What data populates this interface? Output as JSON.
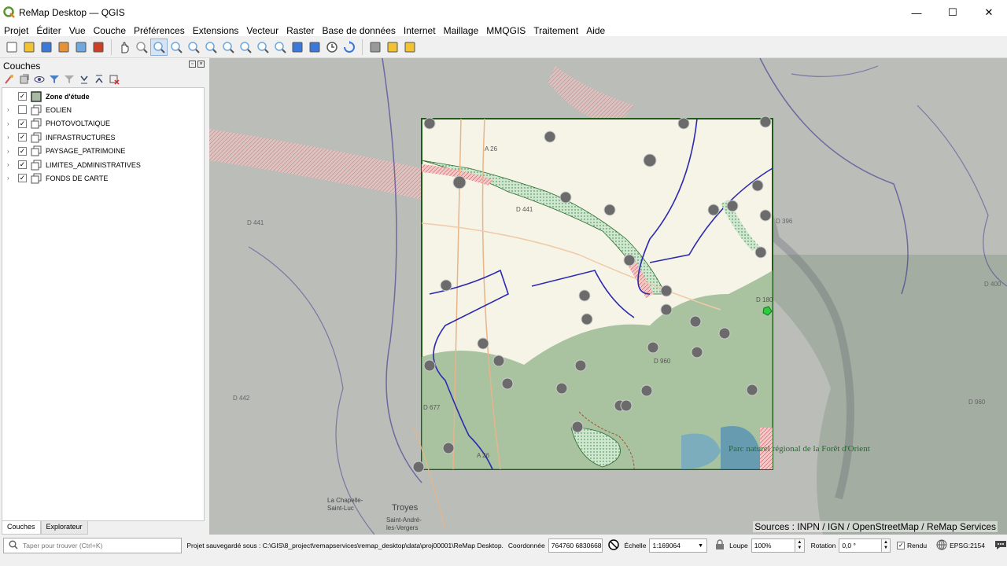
{
  "window": {
    "title": "ReMap Desktop — QGIS",
    "minimize": "—",
    "maximize": "☐",
    "close": "✕"
  },
  "menu": [
    "Projet",
    "Éditer",
    "Vue",
    "Couche",
    "Préférences",
    "Extensions",
    "Vecteur",
    "Raster",
    "Base de données",
    "Internet",
    "Maillage",
    "MMQGIS",
    "Traitement",
    "Aide"
  ],
  "toolbar_icons": [
    "new-project",
    "open-project",
    "save-project",
    "save-as",
    "print-layout",
    "style-manager",
    "pan",
    "pan-to-selection",
    "zoom-in",
    "zoom-out",
    "zoom-full",
    "zoom-to-selection",
    "zoom-to-layer",
    "zoom-native",
    "zoom-last",
    "zoom-next",
    "new-bookmark",
    "show-bookmarks",
    "temporal-controller",
    "refresh",
    "identify",
    "select",
    "deselect"
  ],
  "layers_panel": {
    "title": "Couches",
    "layers": [
      {
        "name": "Zone d'étude",
        "checked": true,
        "bold": true,
        "expandable": false
      },
      {
        "name": "EOLIEN",
        "checked": false,
        "bold": false,
        "expandable": true
      },
      {
        "name": "PHOTOVOLTAIQUE",
        "checked": true,
        "bold": false,
        "expandable": true
      },
      {
        "name": "INFRASTRUCTURES",
        "checked": true,
        "bold": false,
        "expandable": true
      },
      {
        "name": "PAYSAGE_PATRIMOINE",
        "checked": true,
        "bold": false,
        "expandable": true
      },
      {
        "name": "LIMITES_ADMINISTRATIVES",
        "checked": true,
        "bold": false,
        "expandable": true
      },
      {
        "name": "FONDS DE CARTE",
        "checked": true,
        "bold": false,
        "expandable": true
      }
    ],
    "tabs": [
      "Couches",
      "Explorateur"
    ]
  },
  "map": {
    "sources": "Sources : INPN / IGN / OpenStreetMap / ReMap Services",
    "road_labels": [
      "A 26",
      "D 441",
      "D 441",
      "D 396",
      "D 400",
      "D 180",
      "D 960",
      "D 677",
      "A 26",
      "D 442",
      "D 960"
    ],
    "place_labels": [
      "Troyes",
      "La Chapelle-Saint-Luc",
      "Saint-André-les-Vergers",
      "Parc naturel régional de la Forêt d'Orient"
    ]
  },
  "statusbar": {
    "search_placeholder": "Taper pour trouver (Ctrl+K)",
    "saved_message": "Projet sauvegardé sous : C:\\GIS\\8_project\\remapservices\\remap_desktop\\data\\proj00001\\ReMap Desktop.",
    "coord_label": "Coordonnée",
    "coord_value": "764760 6830668",
    "scale_label": "Échelle",
    "scale_value": "1:169064",
    "magnifier_label": "Loupe",
    "magnifier_value": "100%",
    "rotation_label": "Rotation",
    "rotation_value": "0,0 °",
    "render_label": "Rendu",
    "crs": "EPSG:2154"
  }
}
